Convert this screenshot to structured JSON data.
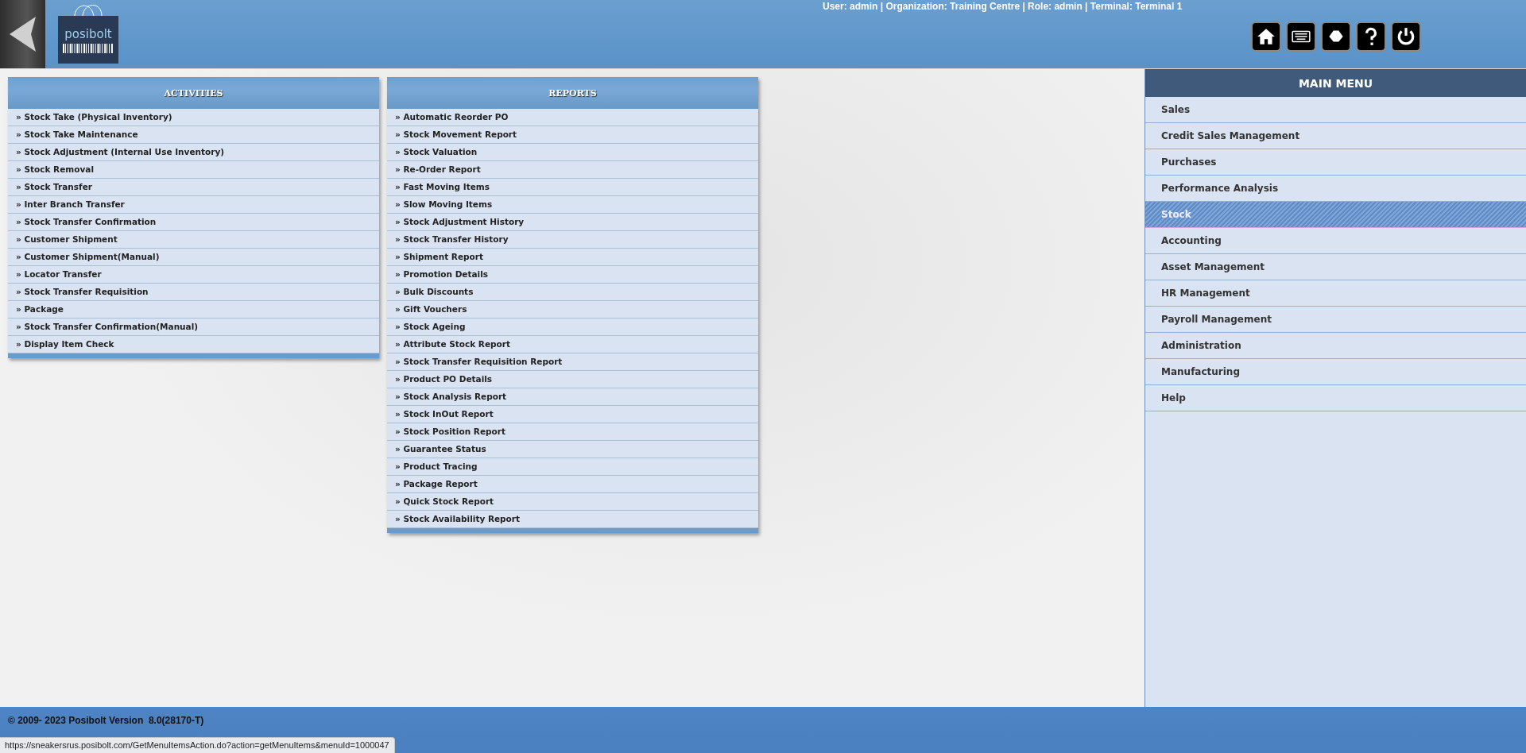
{
  "header": {
    "user_info": "User: admin | Organization: Training Centre | Role: admin | Terminal: Terminal 1",
    "logo_text": "posibolt"
  },
  "activities": {
    "title": "ACTIVITIES",
    "items": [
      "» Stock Take (Physical Inventory)",
      "» Stock Take Maintenance",
      "» Stock Adjustment (Internal Use Inventory)",
      "» Stock Removal",
      "» Stock Transfer",
      "» Inter Branch Transfer",
      "» Stock Transfer Confirmation",
      "» Customer Shipment",
      "» Customer Shipment(Manual)",
      "» Locator Transfer",
      "» Stock Transfer Requisition",
      "» Package",
      "» Stock Transfer Confirmation(Manual)",
      "» Display Item Check"
    ]
  },
  "reports": {
    "title": "REPORTS",
    "items": [
      "» Automatic Reorder PO",
      "» Stock Movement Report",
      "» Stock Valuation",
      "» Re-Order Report",
      "» Fast Moving Items",
      "» Slow Moving Items",
      "» Stock Adjustment History",
      "» Stock Transfer History",
      "» Shipment Report",
      "» Promotion Details",
      "» Bulk Discounts",
      "» Gift Vouchers",
      "» Stock Ageing",
      "» Attribute Stock Report",
      "» Stock Transfer Requisition Report",
      "» Product PO Details",
      "» Stock Analysis Report",
      "» Stock InOut Report",
      "» Stock Position Report",
      "» Guarantee Status",
      "» Product Tracing",
      "» Package Report",
      "» Quick Stock Report",
      "» Stock Availability Report"
    ]
  },
  "main_menu": {
    "title": "MAIN MENU",
    "items": [
      {
        "label": "Sales",
        "selected": false
      },
      {
        "label": "Credit Sales Management",
        "selected": false
      },
      {
        "label": "Purchases",
        "selected": false
      },
      {
        "label": "Performance Analysis",
        "selected": false
      },
      {
        "label": "Stock",
        "selected": true
      },
      {
        "label": "Accounting",
        "selected": false
      },
      {
        "label": "Asset Management",
        "selected": false
      },
      {
        "label": "HR Management",
        "selected": false
      },
      {
        "label": "Payroll Management",
        "selected": false
      },
      {
        "label": "Administration",
        "selected": false
      },
      {
        "label": "Manufacturing",
        "selected": false
      },
      {
        "label": "Help",
        "selected": false
      }
    ]
  },
  "footer": {
    "copyright": "© 2009- 2023 Posibolt Version  8.0(28170-T)"
  },
  "status_url": "https://sneakersrus.posibolt.com/GetMenuItemsAction.do?action=getMenuItems&menuId=1000047"
}
